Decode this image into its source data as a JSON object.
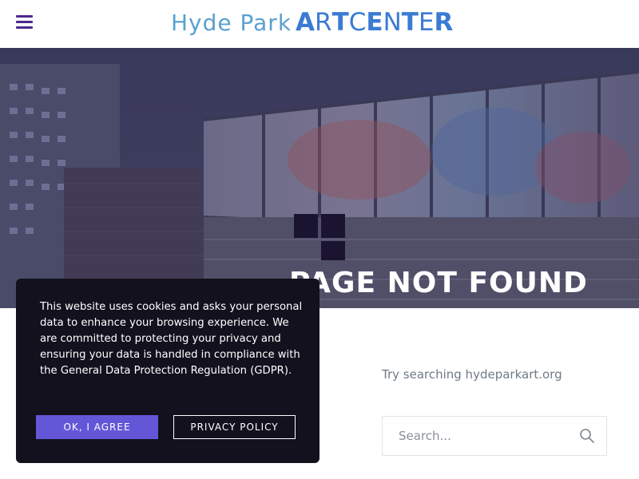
{
  "header": {
    "menu_icon": "hamburger-menu-icon",
    "logo": {
      "light_text": "Hyde Park",
      "bold_letters": [
        "A",
        "R",
        "T",
        "C",
        "E",
        "N",
        "T",
        "E",
        "R"
      ]
    }
  },
  "hero": {
    "image": "hyde-park-art-center-building-photo",
    "title": "PAGE NOT FOUND"
  },
  "search": {
    "hint": "Try searching hydeparkart.org",
    "placeholder": "Search...",
    "icon": "search-icon"
  },
  "cookie_banner": {
    "message": "This website uses cookies and asks your personal data to enhance your browsing experience. We are committed to protecting your privacy and ensuring your data is handled in compliance with the General Data Protection Regulation (GDPR).",
    "agree_label": "OK, I AGREE",
    "policy_label": "PRIVACY POLICY"
  },
  "colors": {
    "brand_purple": "#4a2a8c",
    "logo_blue": "#3b7bd4",
    "agree_button": "#6357d8",
    "banner_bg": "#13111e"
  }
}
